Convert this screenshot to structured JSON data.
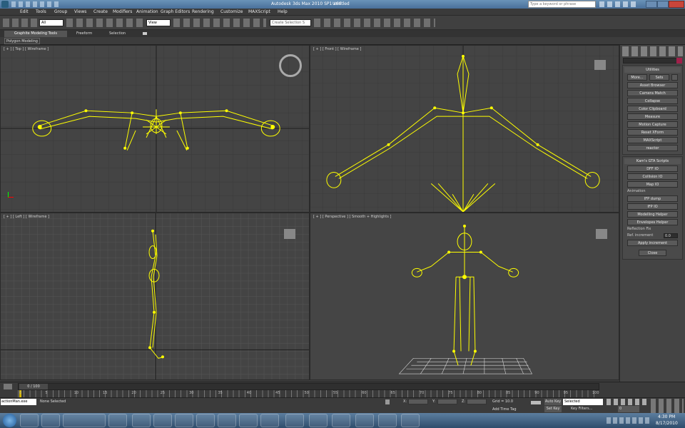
{
  "title": {
    "app": "Autodesk 3ds Max 2010 SP1 x64",
    "doc": "Untitled",
    "search_placeholder": "Type a keyword or phrase"
  },
  "menu": [
    "Edit",
    "Tools",
    "Group",
    "Views",
    "Create",
    "Modifiers",
    "Animation",
    "Graph Editors",
    "Rendering",
    "Customize",
    "MAXScript",
    "Help"
  ],
  "toolbar": {
    "selection_filter": "All",
    "ref_coord": "View",
    "named_selection": "Create Selection S"
  },
  "ribbon": {
    "tabs": [
      "Graphite Modeling Tools",
      "Freeform",
      "Selection"
    ],
    "sub": "Polygon Modeling"
  },
  "viewports": {
    "top": "[ + ] [ Top ] [ Wireframe ]",
    "front": "[ + ] [ Front ] [ Wireframe ]",
    "left": "[ + ] [ Left ] [ Wireframe ]",
    "persp": "[ + ] [ Perspective ] [ Smooth + Highlights ]"
  },
  "panel": {
    "utilities_title": "Utilities",
    "more": "More...",
    "sets": "Sets",
    "utils": [
      "Asset Browser",
      "Camera Match",
      "Collapse",
      "Color Clipboard",
      "Measure",
      "Motion Capture",
      "Reset XForm",
      "MAXScript",
      "reactor"
    ],
    "gta_title": "Kam's GTA Scripts",
    "gta": [
      "DFF IO",
      "Collision IO",
      "Map IO"
    ],
    "anim_label": "Animation",
    "anim": [
      "IFP dump",
      "IFP IO"
    ],
    "helpers": [
      "Modelling Helper",
      "Envelopes Helper"
    ],
    "reflection_label": "Reflection Fix",
    "ref_inc_label": "Ref. increment",
    "ref_inc_value": "0.0",
    "apply": "Apply increment",
    "close": "Close"
  },
  "timeline": {
    "frame": "0 / 100",
    "ticks": [
      "0",
      "5",
      "10",
      "15",
      "20",
      "25",
      "30",
      "35",
      "40",
      "45",
      "50",
      "55",
      "60",
      "65",
      "70",
      "75",
      "80",
      "85",
      "90",
      "95",
      "100"
    ]
  },
  "status": {
    "script": "actionMan.exe",
    "selected": "None Selected",
    "x_label": "X:",
    "y_label": "Y:",
    "z_label": "Z:",
    "grid": "Grid = 10.0",
    "autokey": "Auto Key",
    "setkey": "Set Key",
    "selected_dd": "Selected",
    "keyfilters": "Key Filters...",
    "addtime": "Add Time Tag",
    "frame_val": "0"
  },
  "clock": {
    "time": "4:30 PM",
    "date": "8/17/2010"
  }
}
